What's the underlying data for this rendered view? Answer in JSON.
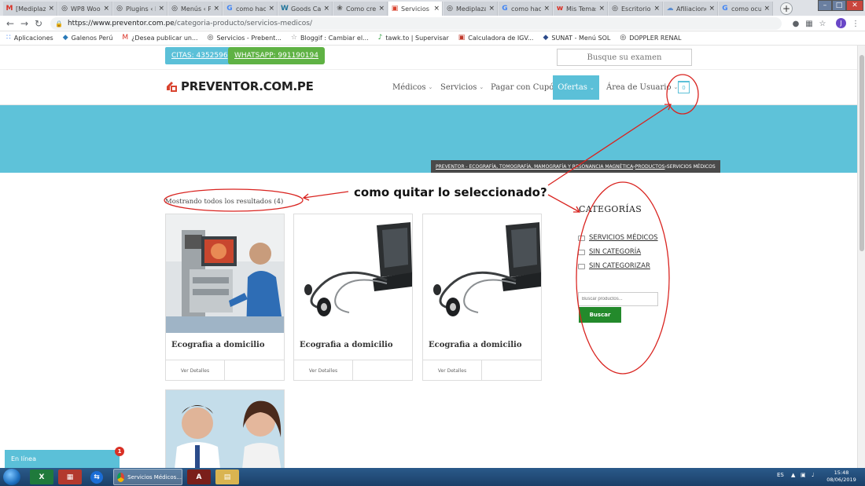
{
  "browser": {
    "tabs": [
      {
        "label": "[Mediplaza]",
        "icon": "gmail-icon",
        "glyph": "M",
        "color": "#d93025"
      },
      {
        "label": "WP8 Woo",
        "icon": "wordpress-icon",
        "glyph": "◎",
        "color": "#333333"
      },
      {
        "label": "Plugins ‹ P",
        "icon": "wordpress-icon",
        "glyph": "◎",
        "color": "#333333"
      },
      {
        "label": "Menús ‹ P",
        "icon": "wordpress-icon",
        "glyph": "◎",
        "color": "#333333"
      },
      {
        "label": "como hac",
        "icon": "google-icon",
        "glyph": "G",
        "color": "#4285f4"
      },
      {
        "label": "Goods Cat",
        "icon": "wordpress-icon",
        "glyph": "W",
        "color": "#21759b"
      },
      {
        "label": "Como crea",
        "icon": "site-icon",
        "glyph": "❀",
        "color": "#555555"
      },
      {
        "label": "Servicios M",
        "icon": "preventor-icon",
        "glyph": "▣",
        "color": "#d9432f",
        "active": true
      },
      {
        "label": "Mediplaza",
        "icon": "wordpress-icon",
        "glyph": "◎",
        "color": "#333333"
      },
      {
        "label": "como hac",
        "icon": "google-icon",
        "glyph": "G",
        "color": "#4285f4"
      },
      {
        "label": "Mis Temas",
        "icon": "themeforest-icon",
        "glyph": "w",
        "color": "#d93025"
      },
      {
        "label": "Escritorio",
        "icon": "wordpress-icon",
        "glyph": "◎",
        "color": "#333333"
      },
      {
        "label": "Afiliacione",
        "icon": "cloud-icon",
        "glyph": "☁",
        "color": "#5a8ccf"
      },
      {
        "label": "como ocul",
        "icon": "google-icon",
        "glyph": "G",
        "color": "#4285f4"
      }
    ],
    "url_host": "https://www.preventor.com.pe",
    "url_path": "/categoria-producto/servicios-medicos/",
    "profile_initial": "J",
    "bookmarks": [
      {
        "label": "Aplicaciones",
        "icon": "apps-icon",
        "glyph": "∷",
        "color": "#4285f4"
      },
      {
        "label": "Galenos Perú",
        "icon": "galenos-icon",
        "glyph": "◆",
        "color": "#2a7ab8"
      },
      {
        "label": "¿Desea publicar un...",
        "icon": "gmail-icon",
        "glyph": "M",
        "color": "#d93025"
      },
      {
        "label": "Servicios - Prebent...",
        "icon": "wordpress-icon",
        "glyph": "◎",
        "color": "#333333"
      },
      {
        "label": "Bloggif : Cambiar el...",
        "icon": "star-icon",
        "glyph": "☆",
        "color": "#888888"
      },
      {
        "label": "tawk.to | Supervisar",
        "icon": "tawk-icon",
        "glyph": "♪",
        "color": "#2a9d3a"
      },
      {
        "label": "Calculadora de IGV...",
        "icon": "calculator-icon",
        "glyph": "▣",
        "color": "#c0392b"
      },
      {
        "label": "SUNAT - Menú SOL",
        "icon": "sunat-icon",
        "glyph": "◆",
        "color": "#2b4a8a"
      },
      {
        "label": "DOPPLER RENAL",
        "icon": "wordpress-icon",
        "glyph": "◎",
        "color": "#333333"
      }
    ]
  },
  "site": {
    "citas_label": "CITAS: 4352596",
    "whatsapp_label": "WHATSAPP: 991190194",
    "exam_search_placeholder": "Busque su examen",
    "logo_text": "PREVENTOR.COM.PE",
    "nav": {
      "medicos": "Médicos",
      "servicios": "Servicios",
      "cupon": "Pagar con Cupón",
      "ofertas": "Ofertas",
      "area": "Área de Usuario"
    },
    "cart_count": "0",
    "breadcrumb": {
      "part1": "PREVENTOR - ECOGRAFÍA, TOMOGRAFÍA, MAMOGRAFÍA Y RESONANCIA MAGNÉTICA",
      "sep": " › ",
      "part2": "PRODUCTOS",
      "part3": "SERVICIOS MÉDICOS"
    },
    "results_text": "Mostrando todos los resultados (4)",
    "products": [
      {
        "title": "Ecografia a domicilio",
        "details": "Ver Detalles"
      },
      {
        "title": "Ecografia a domicilio",
        "details": "Ver Detalles"
      },
      {
        "title": "Ecografia a domicilio",
        "details": "Ver Detalles"
      }
    ],
    "sidebar": {
      "title": "CATEGORÍAS",
      "categories": [
        "SERVICIOS MÉDICOS",
        "SIN CATEGORÍA",
        "SIN CATEGORIZAR"
      ],
      "search_placeholder": "Buscar productos...",
      "search_button": "Buscar"
    },
    "chat": {
      "label": "En línea",
      "badge": "1"
    }
  },
  "annotation": {
    "question": "como quitar lo seleccionado?",
    "color": "#d9231f"
  },
  "taskbar": {
    "chrome_label": "Servicios Médicos...",
    "language": "ES",
    "time": "15:48",
    "date": "08/06/2019"
  }
}
